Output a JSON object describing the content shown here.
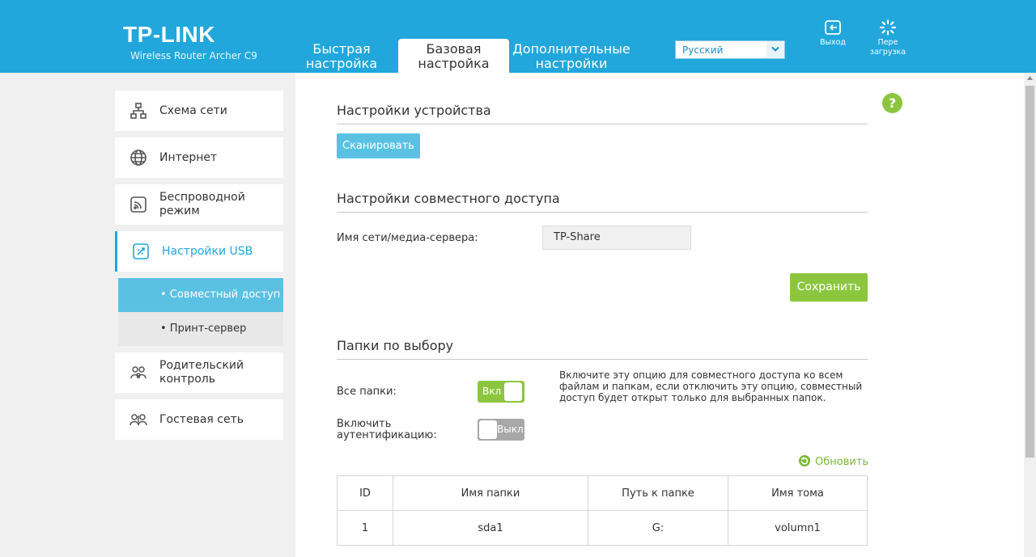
{
  "header": {
    "logo": "TP-LINK",
    "model": "Wireless Router Archer C9",
    "tabs": [
      {
        "line1": "Быстрая",
        "line2": "настройка"
      },
      {
        "line1": "Базовая",
        "line2": "настройка"
      },
      {
        "line1": "Дополнительные",
        "line2": "настройки"
      }
    ],
    "language": "Русский",
    "logout_label": "Выход",
    "reboot_line1": "Пере",
    "reboot_line2": "загрузка"
  },
  "sidebar": {
    "items": [
      {
        "label": "Схема сети",
        "icon": "network-map-icon"
      },
      {
        "label": "Интернет",
        "icon": "globe-icon"
      },
      {
        "line1": "Беспроводной",
        "line2": "режим",
        "icon": "wireless-icon"
      },
      {
        "label": "Настройки USB",
        "icon": "usb-icon"
      },
      {
        "line1": "Родительский",
        "line2": "контроль",
        "icon": "parental-control-icon"
      },
      {
        "label": "Гостевая сеть",
        "icon": "guest-network-icon"
      }
    ],
    "subitems": [
      {
        "label": "• Совместный доступ"
      },
      {
        "label": "• Принт-сервер"
      }
    ]
  },
  "device": {
    "title": "Настройки устройства",
    "scan_label": "Сканировать"
  },
  "sharing": {
    "title": "Настройки совместного доступа",
    "server_label": "Имя сети/медиа-сервера:",
    "server_value": "TP-Share",
    "save_label": "Сохранить"
  },
  "folders": {
    "title": "Папки по выбору",
    "all_label": "Все папки:",
    "all_toggle": "Вкл",
    "auth_line1": "Включить",
    "auth_line2": "аутентификацию:",
    "auth_toggle": "Выкл",
    "description": "Включите эту опцию для совместного доступа ко всем файлам и папкам, если отключить эту опцию, совместный доступ будет открыт только для выбранных папок.",
    "refresh_label": "Обновить",
    "columns": [
      "ID",
      "Имя папки",
      "Путь к папке",
      "Имя тома"
    ],
    "rows": [
      [
        "1",
        "sda1",
        "G:",
        "volumn1"
      ]
    ]
  },
  "help_label": "?",
  "colors": {
    "header": "#21a7dc",
    "accent_green": "#8cc63f",
    "button_blue": "#5bc1e3"
  }
}
